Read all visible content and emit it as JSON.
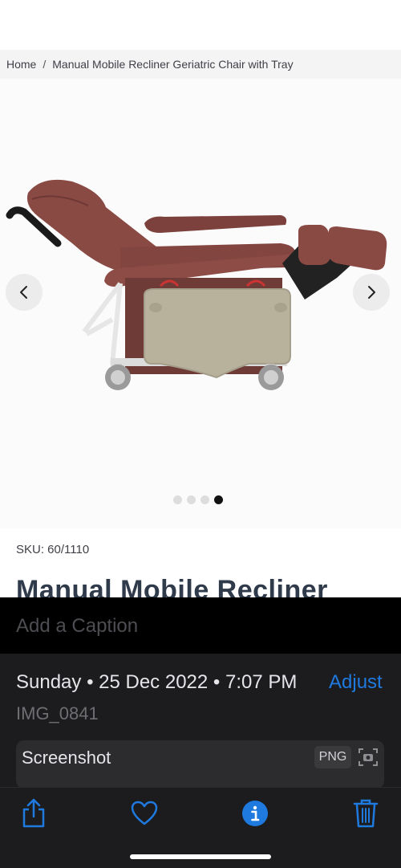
{
  "breadcrumb": {
    "home": "Home",
    "separator": "/",
    "current": "Manual Mobile Recliner Geriatric Chair with Tray"
  },
  "carousel": {
    "slide_count": 4,
    "active_index": 3,
    "prev_icon": "chevron-left-icon",
    "next_icon": "chevron-right-icon"
  },
  "product": {
    "sku": "SKU: 60/1110",
    "title_partial": "Manual Mobile Recliner"
  },
  "photo_info": {
    "caption_placeholder": "Add a Caption",
    "date": "Sunday • 25 Dec 2022 • 7:07 PM",
    "adjust_label": "Adjust",
    "filename": "IMG_0841",
    "source_label": "Screenshot",
    "format_badge": "PNG"
  },
  "toolbar": {
    "share_icon": "share-icon",
    "favorite_icon": "heart-icon",
    "info_icon": "info-icon",
    "delete_icon": "trash-icon"
  },
  "colors": {
    "accent": "#1f7ae0",
    "sheet_bg": "#1c1c1e",
    "chair_upholstery": "#8a4a44",
    "title_text": "#2f3b4a"
  }
}
